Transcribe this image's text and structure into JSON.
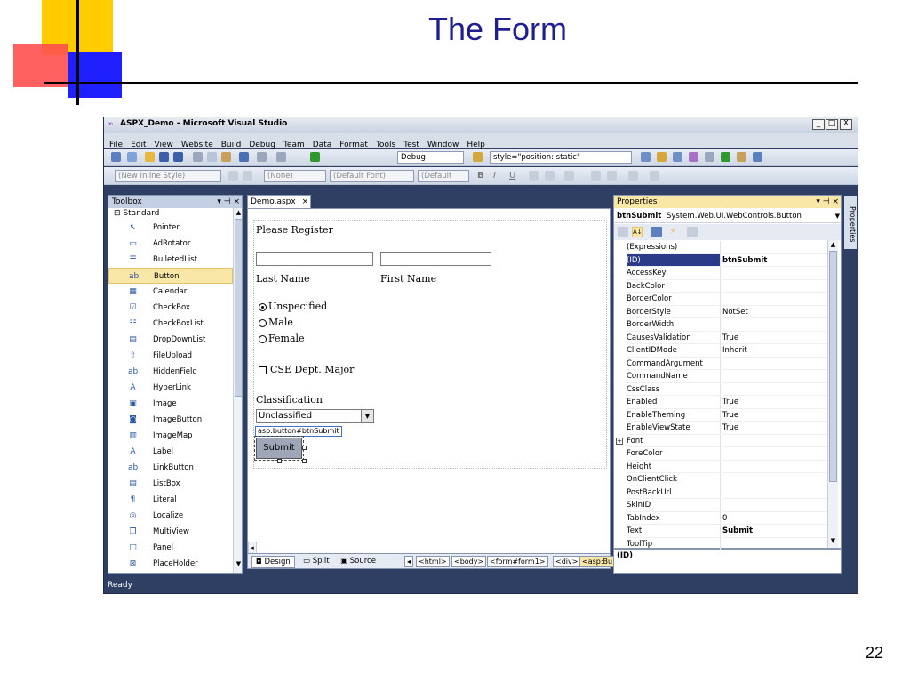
{
  "slide": {
    "title": "The Form",
    "page_number": "22"
  },
  "colors": {
    "slide_title": "#1f1f8f",
    "deco_yellow": "#ffcc00",
    "deco_red": "#ff4444",
    "deco_blue": "#1a1aff",
    "vs_dark": "#2f3e63",
    "selection": "#2b3b8a"
  },
  "window": {
    "title": "ASPX_Demo - Microsoft Visual Studio",
    "min": "_",
    "max": "□",
    "close": "X"
  },
  "menu": [
    "File",
    "Edit",
    "View",
    "Website",
    "Build",
    "Debug",
    "Team",
    "Data",
    "Format",
    "Tools",
    "Test",
    "Window",
    "Help"
  ],
  "toolbar1": {
    "config": "Debug",
    "style": "style=\"position: static\""
  },
  "toolbar2": {
    "inline_style": "(New Inline Style)",
    "none": "(None)",
    "font": "(Default Font)",
    "size": "(Default",
    "bold": "B",
    "italic": "I",
    "underline": "U"
  },
  "toolbox": {
    "header": "Toolbox",
    "pin": "▾ ⊣ ×",
    "section": "⊟ Standard",
    "items": [
      {
        "label": "Pointer",
        "icon": "pointer-icon",
        "glyph": "↖"
      },
      {
        "label": "AdRotator",
        "icon": "adrotator-icon",
        "glyph": "▭"
      },
      {
        "label": "BulletedList",
        "icon": "bulletedlist-icon",
        "glyph": "☰"
      },
      {
        "label": "Button",
        "icon": "button-icon",
        "glyph": "ab"
      },
      {
        "label": "Calendar",
        "icon": "calendar-icon",
        "glyph": "▦"
      },
      {
        "label": "CheckBox",
        "icon": "checkbox-icon",
        "glyph": "☑"
      },
      {
        "label": "CheckBoxList",
        "icon": "checkboxlist-icon",
        "glyph": "☷"
      },
      {
        "label": "DropDownList",
        "icon": "dropdownlist-icon",
        "glyph": "▤"
      },
      {
        "label": "FileUpload",
        "icon": "fileupload-icon",
        "glyph": "⇧"
      },
      {
        "label": "HiddenField",
        "icon": "hiddenfield-icon",
        "glyph": "ab"
      },
      {
        "label": "HyperLink",
        "icon": "hyperlink-icon",
        "glyph": "A"
      },
      {
        "label": "Image",
        "icon": "image-icon",
        "glyph": "▣"
      },
      {
        "label": "ImageButton",
        "icon": "imagebutton-icon",
        "glyph": "◙"
      },
      {
        "label": "ImageMap",
        "icon": "imagemap-icon",
        "glyph": "▥"
      },
      {
        "label": "Label",
        "icon": "label-icon",
        "glyph": "A"
      },
      {
        "label": "LinkButton",
        "icon": "linkbutton-icon",
        "glyph": "ab"
      },
      {
        "label": "ListBox",
        "icon": "listbox-icon",
        "glyph": "▤"
      },
      {
        "label": "Literal",
        "icon": "literal-icon",
        "glyph": "¶"
      },
      {
        "label": "Localize",
        "icon": "localize-icon",
        "glyph": "◎"
      },
      {
        "label": "MultiView",
        "icon": "multiview-icon",
        "glyph": "❐"
      },
      {
        "label": "Panel",
        "icon": "panel-icon",
        "glyph": "□"
      },
      {
        "label": "PlaceHolder",
        "icon": "placeholder-icon",
        "glyph": "⊠"
      }
    ],
    "selected_index": 3
  },
  "designer": {
    "tab": "Demo.aspx",
    "tab_close": "×",
    "heading": "Please Register",
    "last_name_label": "Last Name",
    "first_name_label": "First Name",
    "radio_options": [
      "Unspecified",
      "Male",
      "Female"
    ],
    "radio_selected": 0,
    "checkbox_label": "CSE Dept. Major",
    "classification_label": "Classification",
    "classification_value": "Unclassified",
    "selection_tag": "asp:button#btnSubmit",
    "submit_label": "Submit",
    "views": {
      "design": "Design",
      "split": "Split",
      "source": "Source"
    },
    "breadcrumbs": [
      "<html>",
      "<body>",
      "<form#form1>",
      "<div>",
      "<asp:Bu"
    ]
  },
  "properties": {
    "header": "Properties",
    "object_name": "btnSubmit",
    "object_type": "System.Web.UI.WebControls.Button",
    "rows": [
      {
        "name": "(Expressions)",
        "value": ""
      },
      {
        "name": "(ID)",
        "value": "btnSubmit"
      },
      {
        "name": "AccessKey",
        "value": ""
      },
      {
        "name": "BackColor",
        "value": ""
      },
      {
        "name": "BorderColor",
        "value": ""
      },
      {
        "name": "BorderStyle",
        "value": "NotSet"
      },
      {
        "name": "BorderWidth",
        "value": ""
      },
      {
        "name": "CausesValidation",
        "value": "True"
      },
      {
        "name": "ClientIDMode",
        "value": "Inherit"
      },
      {
        "name": "CommandArgument",
        "value": ""
      },
      {
        "name": "CommandName",
        "value": ""
      },
      {
        "name": "CssClass",
        "value": ""
      },
      {
        "name": "Enabled",
        "value": "True"
      },
      {
        "name": "EnableTheming",
        "value": "True"
      },
      {
        "name": "EnableViewState",
        "value": "True"
      },
      {
        "name": "Font",
        "value": ""
      },
      {
        "name": "ForeColor",
        "value": ""
      },
      {
        "name": "Height",
        "value": ""
      },
      {
        "name": "OnClientClick",
        "value": ""
      },
      {
        "name": "PostBackUrl",
        "value": ""
      },
      {
        "name": "SkinID",
        "value": ""
      },
      {
        "name": "TabIndex",
        "value": "0"
      },
      {
        "name": "Text",
        "value": "Submit"
      },
      {
        "name": "ToolTip",
        "value": ""
      }
    ],
    "selected_row": 1,
    "description_title": "(ID)",
    "side_tab": "Properties"
  },
  "status": {
    "text": "Ready"
  }
}
